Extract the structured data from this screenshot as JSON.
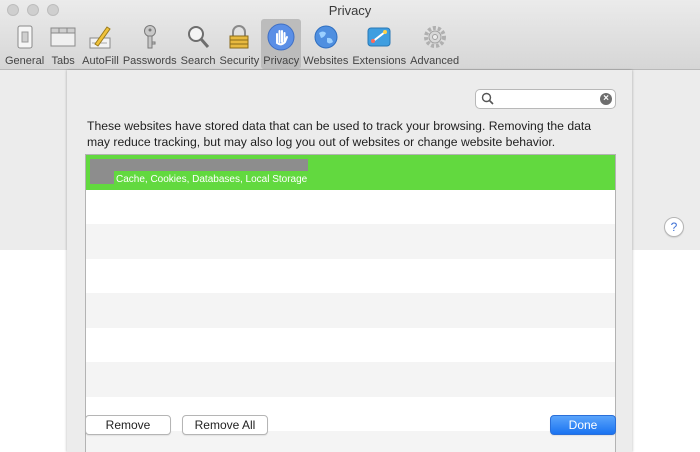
{
  "window": {
    "title": "Privacy"
  },
  "toolbar": {
    "items": [
      {
        "label": "General",
        "icon": "general-switch-icon"
      },
      {
        "label": "Tabs",
        "icon": "tabs-icon"
      },
      {
        "label": "AutoFill",
        "icon": "autofill-pencil-icon"
      },
      {
        "label": "Passwords",
        "icon": "key-icon"
      },
      {
        "label": "Search",
        "icon": "magnifier-icon"
      },
      {
        "label": "Security",
        "icon": "padlock-icon"
      },
      {
        "label": "Privacy",
        "icon": "hand-icon",
        "active": true
      },
      {
        "label": "Websites",
        "icon": "globe-icon"
      },
      {
        "label": "Extensions",
        "icon": "extensions-icon"
      },
      {
        "label": "Advanced",
        "icon": "gear-icon"
      }
    ]
  },
  "sheet": {
    "search": {
      "value": "",
      "placeholder": ""
    },
    "description": "These websites have stored data that can be used to track your browsing. Removing the data may reduce tracking, but may also log you out of websites or change website behavior.",
    "list": {
      "rows": [
        {
          "detail": "Cache, Cookies, Databases, Local Storage",
          "selected": true
        }
      ]
    },
    "buttons": {
      "remove": "Remove",
      "remove_all": "Remove All",
      "done": "Done"
    }
  },
  "help": {
    "label": "?"
  },
  "colors": {
    "selection": "#62d93f",
    "accent": "#1a73f1"
  }
}
